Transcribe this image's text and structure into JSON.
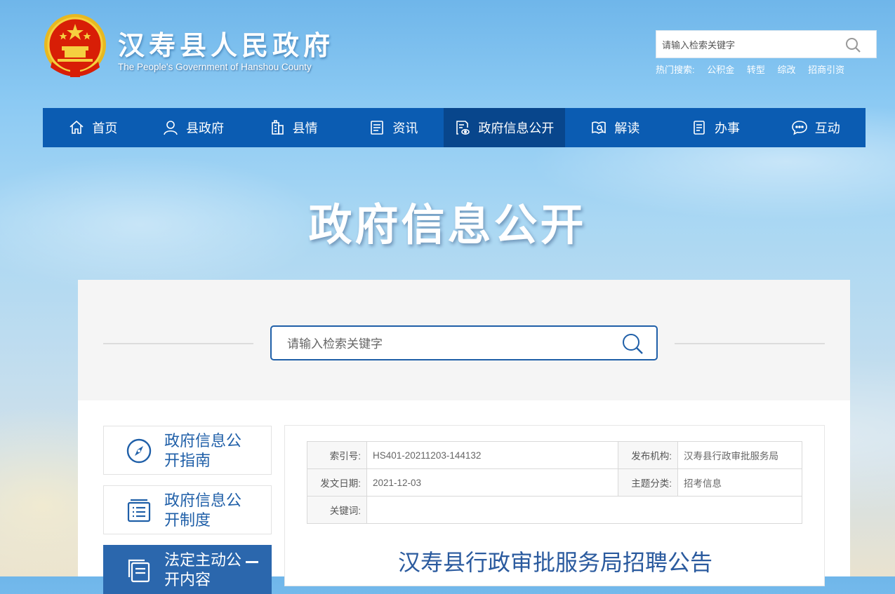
{
  "header": {
    "title": "汉寿县人民政府",
    "subtitle": "The People's Government of Hanshou County",
    "search_placeholder": "请输入检索关键字",
    "hot_label": "热门搜索:",
    "hot_links": [
      "公积金",
      "转型",
      "综改",
      "招商引资"
    ]
  },
  "nav": {
    "items": [
      {
        "label": "首页",
        "icon": "home-icon"
      },
      {
        "label": "县政府",
        "icon": "user-icon"
      },
      {
        "label": "县情",
        "icon": "building-icon"
      },
      {
        "label": "资讯",
        "icon": "news-icon"
      },
      {
        "label": "政府信息公开",
        "icon": "document-eye-icon",
        "active": true
      },
      {
        "label": "解读",
        "icon": "book-search-icon"
      },
      {
        "label": "办事",
        "icon": "clipboard-icon"
      },
      {
        "label": "互动",
        "icon": "chat-icon"
      }
    ]
  },
  "hero": {
    "title": "政府信息公开"
  },
  "search": {
    "placeholder": "请输入检索关键字"
  },
  "sidebar": {
    "items": [
      {
        "label": "政府信息公开指南",
        "icon": "compass-icon"
      },
      {
        "label": "政府信息公开制度",
        "icon": "list-document-icon"
      },
      {
        "label": "法定主动公开内容",
        "icon": "documents-icon",
        "active": true
      }
    ]
  },
  "article": {
    "meta": {
      "index_label": "索引号:",
      "index_value": "HS401-20211203-144132",
      "publisher_label": "发布机构:",
      "publisher_value": "汉寿县行政审批服务局",
      "date_label": "发文日期:",
      "date_value": "2021-12-03",
      "category_label": "主题分类:",
      "category_value": "招考信息",
      "keywords_label": "关键词:",
      "keywords_value": ""
    },
    "title": "汉寿县行政审批服务局招聘公告"
  },
  "colors": {
    "nav_bg": "#0b5cb2",
    "nav_active": "#08468c",
    "accent": "#1f5fa8"
  }
}
